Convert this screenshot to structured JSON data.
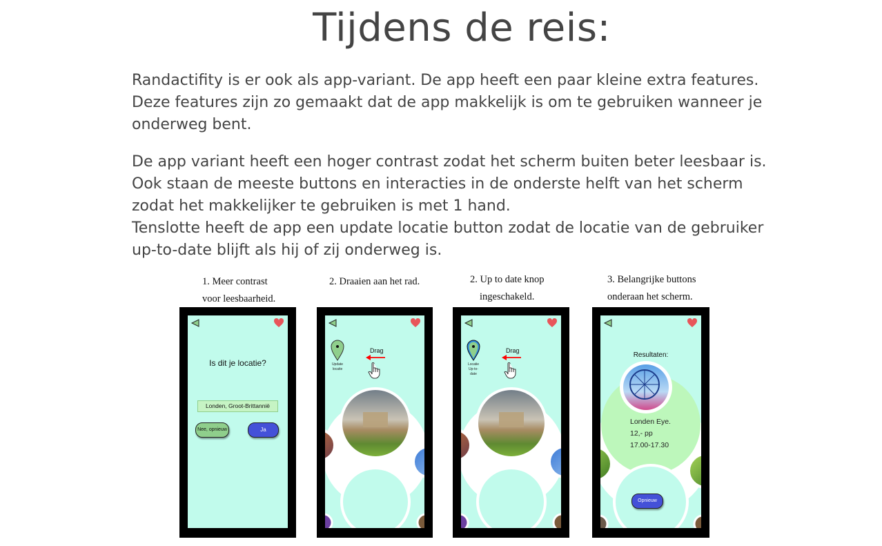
{
  "page": {
    "title": "Tijdens de reis:",
    "paragraph1": "Randactifity is er ook als app-variant. De app heeft een paar kleine extra features. Deze features zijn zo gemaakt dat de app makkelijk is om te gebruiken wanneer je onderweg bent.",
    "paragraph2_lines": [
      "De app variant heeft een hoger contrast zodat het scherm buiten beter leesbaar is. Ook staan de meeste buttons en interacties in de onderste helft van het scherm zodat het makkelijker te gebruiken is met 1 hand.",
      "Tenslotte heeft de app een update locatie button zodat de locatie van de gebruiker up-to-date blijft als hij of zij onderweg is."
    ]
  },
  "captions": [
    {
      "line1": "1. Meer contrast",
      "line2": "voor leesbaarheid."
    },
    {
      "line1": "2. Draaien aan het rad.",
      "line2": ""
    },
    {
      "line1": "2. Up to date knop",
      "line2": "ingeschakeld."
    },
    {
      "line1": "3. Belangrijke buttons",
      "line2": "onderaan het scherm."
    }
  ],
  "phone1": {
    "question": "Is dit je locatie?",
    "location_value": "Londen, Groot-Brittannië",
    "no_button": "Nee, opnieuw",
    "yes_button": "Ja"
  },
  "phone2": {
    "pin_label_1": "Update",
    "pin_label_2": "locatie",
    "drag_label": "Drag"
  },
  "phone3": {
    "pin_label_1": "Locatie",
    "pin_label_2": "Up-to-date",
    "drag_label": "Drag"
  },
  "phone4": {
    "results_title": "Resultaten:",
    "result_name": "Londen Eye.",
    "result_price": "12,- pp",
    "result_time": "17.00-17.30",
    "again_button": "Opnieuw"
  },
  "colors": {
    "text": "#444444",
    "screen_bg": "#c1fbec",
    "accent_green": "#8fcf8c",
    "button_blue": "#4451d8",
    "heart": "#e8555a",
    "drag_arrow": "#ff0000"
  },
  "icons": [
    "back-triangle-icon",
    "heart-icon",
    "location-pin-icon",
    "hand-pointer-icon",
    "arrow-left-icon"
  ]
}
